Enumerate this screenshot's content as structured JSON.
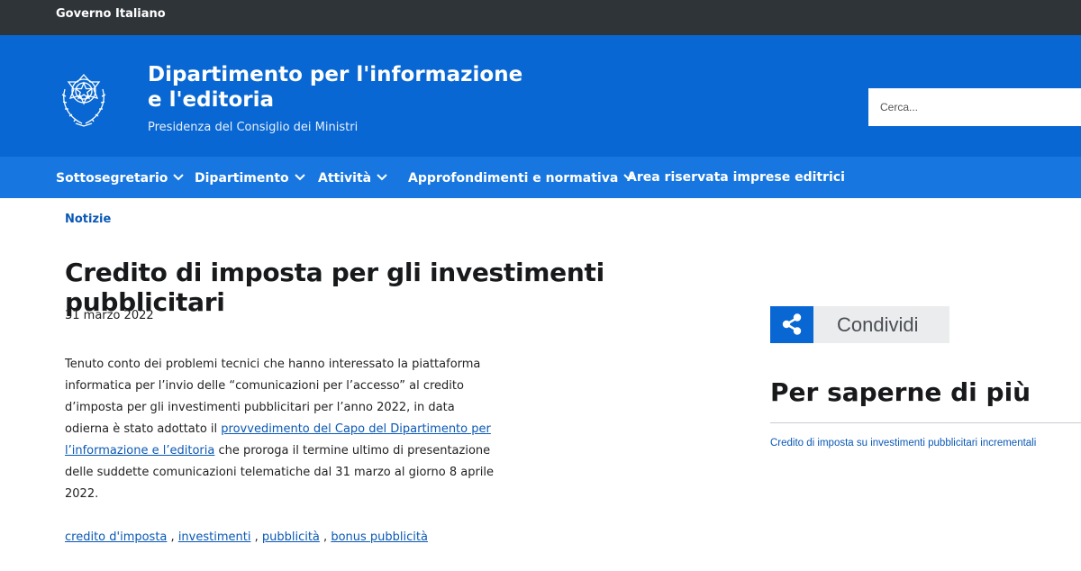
{
  "topbar": {
    "label": "Governo Italiano"
  },
  "header": {
    "title": "Dipartimento per l'informazione e l'editoria",
    "subtitle": "Presidenza del Consiglio dei Ministri",
    "search_placeholder": "Cerca..."
  },
  "nav": {
    "items": [
      {
        "label": "Sottosegretario"
      },
      {
        "label": "Dipartimento"
      },
      {
        "label": "Attività"
      },
      {
        "label": "Approfondimenti e normativa"
      },
      {
        "label": "Area riservata imprese editrici"
      }
    ]
  },
  "breadcrumb": {
    "label": "Notizie"
  },
  "article": {
    "title": "Credito di imposta per gli investimenti pubblicitari",
    "date": "31 marzo 2022",
    "body_before": "Tenuto conto dei problemi tecnici che hanno interessato la piattaforma informatica per l’invio delle “comunicazioni per l’accesso” al credito d’imposta per gli investimenti pubblicitari per l’anno 2022,  in data odierna è stato adottato il ",
    "body_link": "provvedimento del Capo del Dipartimento per l’informazione e l’editoria",
    "body_after": " che proroga il termine ultimo di presentazione delle suddette comunicazioni telematiche dal 31 marzo al giorno 8 aprile 2022.",
    "tags": [
      "credito d'imposta",
      "investimenti",
      "pubblicità",
      "bonus pubblicità"
    ],
    "tag_separator": " , "
  },
  "sidebar": {
    "share_label": "Condividi",
    "title": "Per saperne di più",
    "links": [
      {
        "label": "Credito di imposta su investimenti pubblicitari incrementali"
      }
    ]
  },
  "colors": {
    "topbar": "#2f3439",
    "header": "#0867d2",
    "nav": "#1776df",
    "link": "#0a58b5"
  }
}
